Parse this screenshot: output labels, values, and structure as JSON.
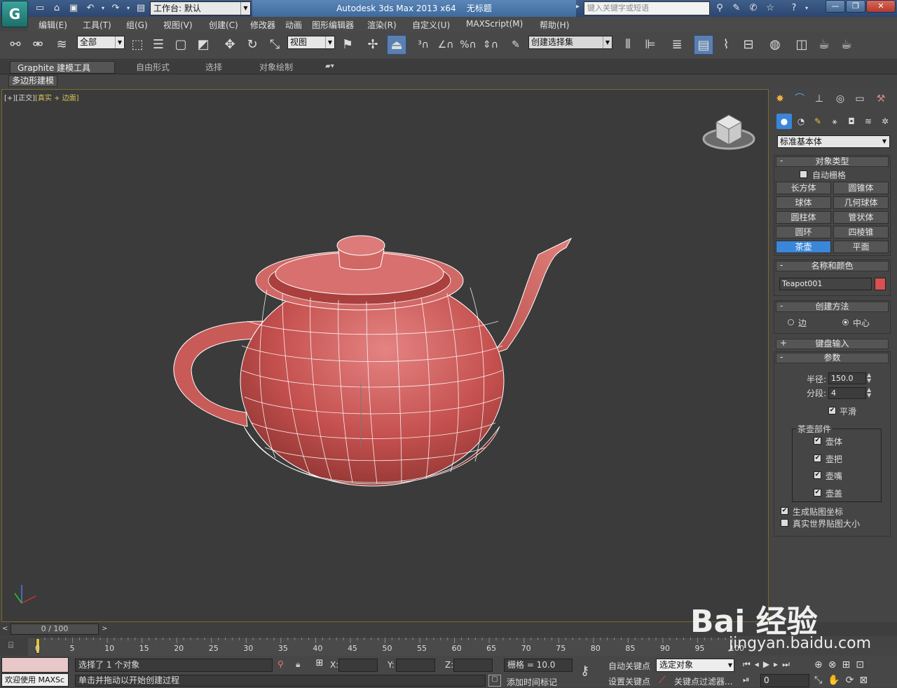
{
  "app": {
    "workspace_label": "工作台: 默认",
    "title": "Autodesk 3ds Max  2013 x64",
    "doc_name": "无标题",
    "search_placeholder": "键入关键字或短语"
  },
  "menu": [
    "编辑(E)",
    "工具(T)",
    "组(G)",
    "视图(V)",
    "创建(C)",
    "修改器",
    "动画",
    "图形编辑器",
    "渲染(R)",
    "自定义(U)",
    "MAXScript(M)",
    "帮助(H)"
  ],
  "toolbar": {
    "selection_filter": "全部",
    "ref_coord": "视图",
    "named_selection": "创建选择集"
  },
  "ribbon": {
    "tabs": [
      "Graphite 建模工具",
      "自由形式",
      "选择",
      "对象绘制"
    ],
    "active_panel": "多边形建模"
  },
  "viewport": {
    "label_plus": "[+]",
    "label_view": "[正交]",
    "label_shading": "[真实 + 边面]",
    "object_color": "#c85a58",
    "wire_color": "#ffffff"
  },
  "command_panel": {
    "category": "标准基本体",
    "object_type": {
      "title": "对象类型",
      "autogrid_label": "自动栅格",
      "buttons": [
        "长方体",
        "圆锥体",
        "球体",
        "几何球体",
        "圆柱体",
        "管状体",
        "圆环",
        "四棱锥",
        "茶壶",
        "平面"
      ],
      "active": "茶壶"
    },
    "name_color": {
      "title": "名称和颜色",
      "name": "Teapot001",
      "color": "#d95050"
    },
    "creation_method": {
      "title": "创建方法",
      "options": [
        "边",
        "中心"
      ],
      "selected": "中心"
    },
    "keyboard_entry": {
      "title": "键盘输入"
    },
    "parameters": {
      "title": "参数",
      "radius_label": "半径:",
      "radius": "150.0",
      "segments_label": "分段:",
      "segments": "4",
      "smooth_label": "平滑",
      "parts_title": "茶壶部件",
      "parts": [
        "壶体",
        "壶把",
        "壶嘴",
        "壶盖"
      ],
      "gen_map_label": "生成贴图坐标",
      "real_world_label": "真实世界贴图大小"
    }
  },
  "timeline": {
    "slider": "0 / 100",
    "ticks": [
      "0",
      "5",
      "10",
      "15",
      "20",
      "25",
      "30",
      "35",
      "40",
      "45",
      "50",
      "55",
      "60",
      "65",
      "70",
      "75",
      "80",
      "85",
      "90",
      "95",
      "100"
    ]
  },
  "status": {
    "welcome": "欢迎使用 MAXSc",
    "selected": "选择了 1 个对象",
    "prompt": "单击并拖动以开始创建过程",
    "x_label": "X:",
    "y_label": "Y:",
    "z_label": "Z:",
    "grid": "栅格 = 10.0",
    "auto_key": "自动关键点",
    "set_key": "设置关键点",
    "key_target": "选定对象",
    "key_filters": "关键点过滤器...",
    "add_time_tag": "添加时间标记",
    "frame": "0"
  },
  "watermark": {
    "text": "Bai 经验",
    "url": "jingyan.baidu.com"
  }
}
